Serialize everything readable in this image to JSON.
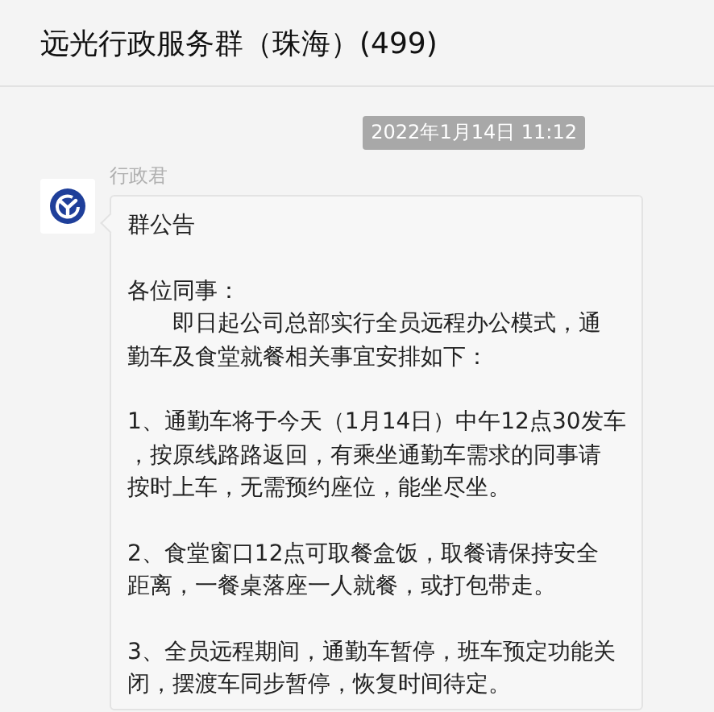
{
  "header": {
    "title": "远光行政服务群（珠海）(499)"
  },
  "messages": [
    {
      "timestamp": "2022年1月14日 11:12",
      "sender": "行政君",
      "paragraphs": [
        {
          "lines": [
            "群公告"
          ]
        },
        {
          "lines": [
            "各位同事：",
            "　　即日起公司总部实行全员远程办公模式，通",
            "勤车及食堂就餐相关事宜安排如下："
          ]
        },
        {
          "lines": [
            "1、通勤车将于今天（1月14日）中午12点30发车",
            "，按原线路路返回，有乘坐通勤车需求的同事请",
            "按时上车，无需预约座位，能坐尽坐。"
          ]
        },
        {
          "lines": [
            "2、食堂窗口12点可取餐盒饭，取餐请保持安全",
            "距离，一餐桌落座一人就餐，或打包带走。"
          ]
        },
        {
          "lines": [
            "3、全员远程期间，通勤车暂停，班车预定功能关",
            "闭，摆渡车同步暂停，恢复时间待定。"
          ]
        }
      ]
    }
  ]
}
